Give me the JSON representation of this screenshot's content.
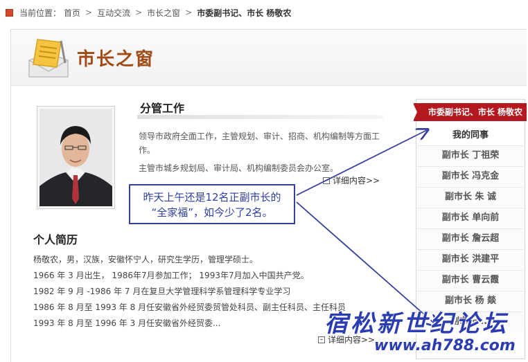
{
  "breadcrumb": {
    "prefix": "当前位置：",
    "items": [
      "首页",
      "互动交流",
      "市长之窗"
    ],
    "current": "市委副书记、市长  杨敬农"
  },
  "header": {
    "title": "市长之窗"
  },
  "duties": {
    "title": "分管工作",
    "line1": "领导市政府全面工作，主管规划、审计、招商、机构编制等方面工作。",
    "line2": "主管市城乡规划局、审计局、机构编制委员会办公室。",
    "more": "详细内容>>"
  },
  "callout": {
    "line1": "昨天上午还是12名正副市长的",
    "line2": "“全家福”，如今少了2名。"
  },
  "resume": {
    "title": "个人简历",
    "lines": [
      "杨敬农，男，汉族，安徽怀宁人，研究生学历，管理学硕士。",
      "1966 年 3 月出生， 1986年7月参加工作； 1993年7月加入中国共产党。",
      "1982 年 9 月 -1986 年 7 月在复旦大学管理科学系管理科学专业学习",
      "1986 年 8 月至 1993 年 8 月任安徽省外经贸委贸管处科员、副主任科员、主任科员",
      "1993 年 8 月至 1996 年 3 月任安徽省外经贸委..."
    ],
    "more": "详细内容>>"
  },
  "sidebar": {
    "ribbon": "市委副书记、市长  杨敬农",
    "title": "我的同事",
    "colleagues": [
      "副市长  丁祖荣",
      "副市长  冯克金",
      "副市长  朱    诚",
      "副市长  单向前",
      "副市长  詹云超",
      "副市长  洪建平",
      "副市长  曹云霞",
      "副市长  杨    燚",
      "副市长  ..."
    ]
  },
  "watermark": {
    "chinese": "宿松新世纪论坛",
    "url": "www.ah788.com"
  },
  "colors": {
    "accent_red": "#b3191f",
    "title_brown": "#a04a14",
    "annotation_blue": "#34409a"
  }
}
